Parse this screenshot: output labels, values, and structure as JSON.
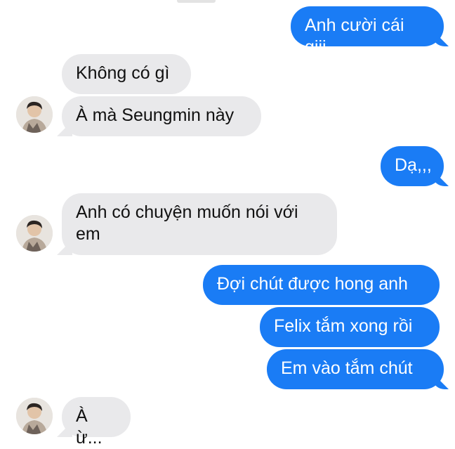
{
  "conversation": {
    "messages": [
      {
        "text": "Anh cười cái giii",
        "sender": "me"
      },
      {
        "text": "Không có gì",
        "sender": "them"
      },
      {
        "text": "À mà Seungmin này",
        "sender": "them"
      },
      {
        "text": "Dạ,,,",
        "sender": "me"
      },
      {
        "text": "Anh có chuyện muốn nói với\nem",
        "sender": "them"
      },
      {
        "text": "Đợi chút được hong anh",
        "sender": "me"
      },
      {
        "text": "Felix tắm xong rồi",
        "sender": "me"
      },
      {
        "text": "Em vào tắm chút",
        "sender": "me"
      },
      {
        "text": "À ừ...",
        "sender": "them"
      }
    ]
  },
  "colors": {
    "outgoing_bubble": "#1a7cf5",
    "incoming_bubble": "#e9e9eb",
    "outgoing_text": "#ffffff",
    "incoming_text": "#111111"
  }
}
